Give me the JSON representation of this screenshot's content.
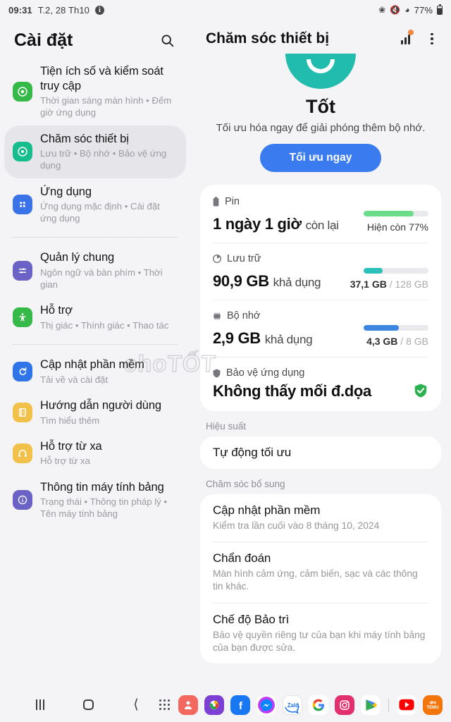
{
  "statusbar": {
    "time": "09:31",
    "date": "T.2, 28 Th10",
    "info_icon": "info-circle-icon",
    "bluetooth_icon": "bluetooth-icon",
    "mute_icon": "sound-mute-icon",
    "wifi_icon": "wifi-icon",
    "battery_percent": "77%"
  },
  "sidebar": {
    "title": "Cài đặt",
    "search_icon": "search-icon",
    "items": [
      {
        "title": "Tiện ích số và kiểm soát truy cập",
        "sub": "Thời gian sáng màn hình • Đếm giờ ứng dụng",
        "icon": "digital-wellbeing-icon",
        "color": "#35ba4a",
        "selected": false
      },
      {
        "title": "Chăm sóc thiết bị",
        "sub": "Lưu trữ • Bộ nhớ • Bảo vệ ứng dụng",
        "icon": "device-care-icon",
        "color": "#17bd8d",
        "selected": true
      },
      {
        "title": "Ứng dụng",
        "sub": "Ứng dụng mặc định • Cài đặt ứng dụng",
        "icon": "apps-grid-icon",
        "color": "#3a72e8",
        "selected": false
      },
      {
        "title": "Quản lý chung",
        "sub": "Ngôn ngữ và bàn phím • Thời gian",
        "icon": "sliders-icon",
        "color": "#6a62c4",
        "selected": false
      },
      {
        "title": "Hỗ trợ",
        "sub": "Thị giác • Thính giác • Thao tác",
        "icon": "accessibility-icon",
        "color": "#35ba4a",
        "selected": false
      },
      {
        "title": "Cập nhật phần mềm",
        "sub": "Tải về và cài đặt",
        "icon": "software-update-icon",
        "color": "#2f74e8",
        "selected": false
      },
      {
        "title": "Hướng dẫn người dùng",
        "sub": "Tìm hiểu thêm",
        "icon": "user-manual-icon",
        "color": "#f2c14a",
        "selected": false
      },
      {
        "title": "Hỗ trợ từ xa",
        "sub": "Hỗ trợ từ xa",
        "icon": "headset-icon",
        "color": "#f2c14a",
        "selected": false
      },
      {
        "title": "Thông tin máy tính bảng",
        "sub": "Trạng thái • Thông tin pháp lý • Tên máy tính bảng",
        "icon": "tablet-info-icon",
        "color": "#6a62c4",
        "selected": false
      }
    ],
    "dividers_after": [
      2,
      4
    ]
  },
  "detail": {
    "title": "Chăm sóc thiết bị",
    "chart_icon": "bar-chart-icon",
    "menu_icon": "more-options-icon",
    "hero": {
      "face_icon": "smiley-face-icon",
      "status": "Tốt",
      "subtitle": "Tối ưu hóa ngay để giải phóng thêm bộ nhớ.",
      "button_label": "Tối ưu ngay",
      "button_color": "#3a7bf0"
    },
    "metrics": [
      {
        "label": "Pin",
        "icon": "battery-icon",
        "main_value": "1 ngày 1 giờ",
        "main_suffix": "còn lại",
        "note": "Hiện còn 77%",
        "note_muted": "",
        "bar_percent": 77,
        "bar_color": "#6bdd8a"
      },
      {
        "label": "Lưu trữ",
        "icon": "storage-pie-icon",
        "main_value": "90,9 GB",
        "main_suffix": "khả dụng",
        "note": "37,1 GB",
        "note_muted": " / 128 GB",
        "bar_percent": 29,
        "bar_color": "#2cc0bb"
      },
      {
        "label": "Bộ nhớ",
        "icon": "memory-chip-icon",
        "main_value": "2,9 GB",
        "main_suffix": "khả dụng",
        "note": "4,3 GB",
        "note_muted": " / 8 GB",
        "bar_percent": 54,
        "bar_color": "#3a86e0"
      },
      {
        "label": "Bảo vệ ứng dụng",
        "icon": "shield-icon",
        "main_value": "Không thấy mối đ.dọa",
        "main_suffix": "",
        "note": "",
        "note_muted": "",
        "status_icon": "shield-check-icon",
        "status_color": "#2bb14f"
      }
    ],
    "performance": {
      "section_label": "Hiệu suất",
      "row_title": "Tự động tối ưu"
    },
    "extra_care": {
      "section_label": "Chăm sóc bổ sung",
      "rows": [
        {
          "title": "Cập nhật phần mềm",
          "sub": "Kiểm tra lần cuối vào 8 tháng 10, 2024"
        },
        {
          "title": "Chẩn đoán",
          "sub": "Màn hình cảm ứng, cảm biến, sạc và các thông tin khác."
        },
        {
          "title": "Chế độ Bảo trì",
          "sub": "Bảo vệ quyền riêng tư của bạn khi máy tính bảng của bạn được sửa."
        }
      ]
    }
  },
  "watermark": {
    "text": "choTỐT"
  },
  "navbar": {
    "recents_icon": "recents-icon",
    "home_icon": "home-icon",
    "back_icon": "back-icon",
    "app_drawer_icon": "app-drawer-icon",
    "apps": [
      {
        "name": "contacts-app-icon",
        "label": "",
        "bg": "#f2685f"
      },
      {
        "name": "gallery-app-icon",
        "label": "",
        "bg": "#7b3fd4"
      },
      {
        "name": "facebook-app-icon",
        "label": "f",
        "bg": "#1877f2"
      },
      {
        "name": "messenger-app-icon",
        "label": "",
        "bg": "#ffffff"
      },
      {
        "name": "zalo-app-icon",
        "label": "Zalo",
        "bg": "#ffffff"
      },
      {
        "name": "google-app-icon",
        "label": "G",
        "bg": "#ffffff"
      },
      {
        "name": "instagram-app-icon",
        "label": "",
        "bg": "#e1306c"
      },
      {
        "name": "play-store-app-icon",
        "label": "",
        "bg": "#ffffff"
      }
    ],
    "apps_after_sep": [
      {
        "name": "youtube-app-icon",
        "label": "",
        "bg": "#ffffff"
      },
      {
        "name": "temu-app-icon",
        "label": "TEMU",
        "bg": "#f2760c"
      }
    ]
  }
}
